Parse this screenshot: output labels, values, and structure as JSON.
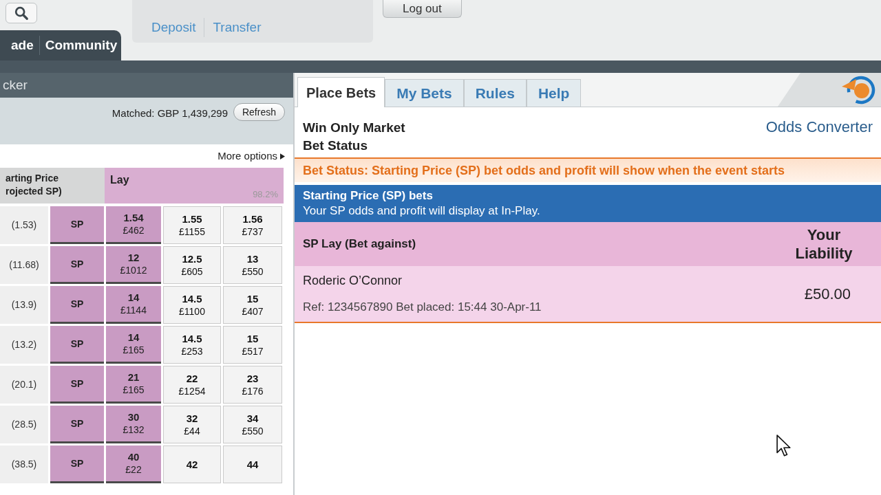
{
  "header": {
    "nav_tabs": [
      "ade",
      "Community"
    ],
    "wallet_links": [
      "Deposit",
      "Transfer"
    ],
    "logout_button": "Log out"
  },
  "market": {
    "ticker_label": "cker",
    "matched": "Matched: GBP 1,439,299",
    "refresh_button": "Refresh",
    "more_options": "More options",
    "columns": {
      "starting_price": "arting Price\nrojected SP)",
      "lay": "Lay",
      "lay_percentage": "98.2%"
    },
    "runners": [
      {
        "projected_sp": "(1.53)",
        "sp_button": "SP",
        "lay_prices": [
          {
            "odds": "1.54",
            "amount": "£462"
          },
          {
            "odds": "1.55",
            "amount": "£1155"
          },
          {
            "odds": "1.56",
            "amount": "£737"
          }
        ]
      },
      {
        "projected_sp": "(11.68)",
        "sp_button": "SP",
        "lay_prices": [
          {
            "odds": "12",
            "amount": "£1012"
          },
          {
            "odds": "12.5",
            "amount": "£605"
          },
          {
            "odds": "13",
            "amount": "£550"
          }
        ]
      },
      {
        "projected_sp": "(13.9)",
        "sp_button": "SP",
        "lay_prices": [
          {
            "odds": "14",
            "amount": "£1144"
          },
          {
            "odds": "14.5",
            "amount": "£1100"
          },
          {
            "odds": "15",
            "amount": "£407"
          }
        ]
      },
      {
        "projected_sp": "(13.2)",
        "sp_button": "SP",
        "lay_prices": [
          {
            "odds": "14",
            "amount": "£165"
          },
          {
            "odds": "14.5",
            "amount": "£253"
          },
          {
            "odds": "15",
            "amount": "£517"
          }
        ]
      },
      {
        "projected_sp": "(20.1)",
        "sp_button": "SP",
        "lay_prices": [
          {
            "odds": "21",
            "amount": "£165"
          },
          {
            "odds": "22",
            "amount": "£1254"
          },
          {
            "odds": "23",
            "amount": "£176"
          }
        ]
      },
      {
        "projected_sp": "(28.5)",
        "sp_button": "SP",
        "lay_prices": [
          {
            "odds": "30",
            "amount": "£132"
          },
          {
            "odds": "32",
            "amount": "£44"
          },
          {
            "odds": "34",
            "amount": "£550"
          }
        ]
      },
      {
        "projected_sp": "(38.5)",
        "sp_button": "SP",
        "lay_prices": [
          {
            "odds": "40",
            "amount": "£22"
          },
          {
            "odds": "42"
          },
          {
            "odds": "44"
          }
        ]
      }
    ]
  },
  "bet_tabs": [
    {
      "label": "Place Bets",
      "selected": true
    },
    {
      "label": "My Bets",
      "selected": false
    },
    {
      "label": "Rules",
      "selected": false
    },
    {
      "label": "Help",
      "selected": false
    }
  ],
  "bet_slip": {
    "market_title": "Win Only Market",
    "section_title": "Bet Status",
    "odds_converter": "Odds Converter",
    "status_notice": "Bet Status: Starting Price (SP) bet odds and profit will show when the event starts",
    "sp_info": {
      "title": "Starting Price (SP) bets",
      "text": "Your SP odds and profit will display at In-Play."
    },
    "bets_header": {
      "title": "SP Lay (Bet against)",
      "liability_label": "Your Liability"
    },
    "bets": [
      {
        "runner": "Roderic O’Connor",
        "ref": "Ref: 1234567890 Bet placed: 15:44 30-Apr-11",
        "liability": "£50.00"
      }
    ]
  }
}
